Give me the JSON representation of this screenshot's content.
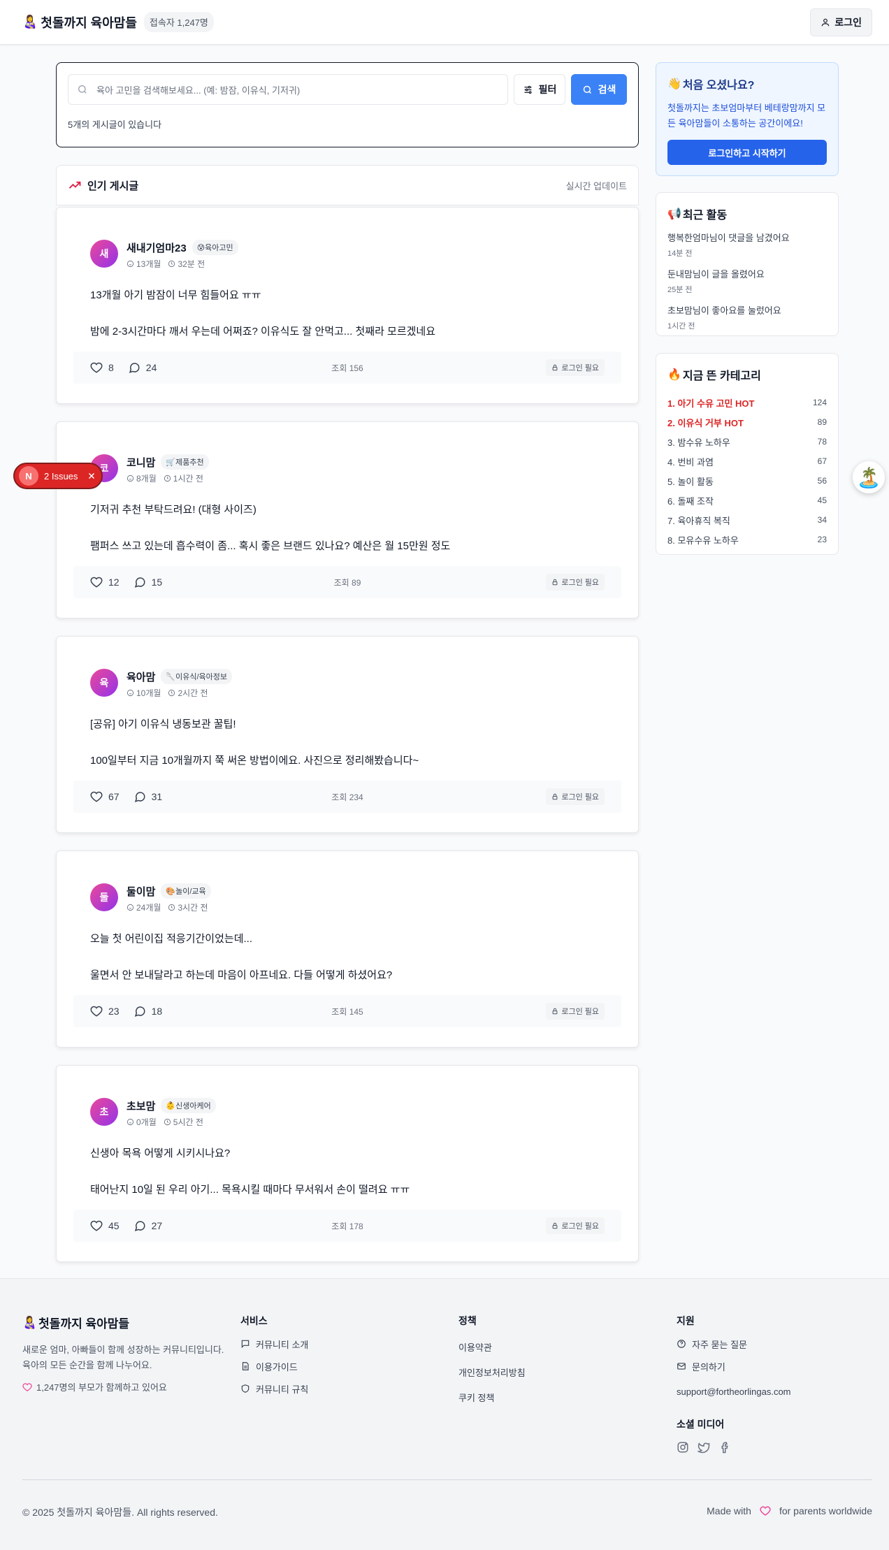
{
  "header": {
    "brand_emoji": "👩‍🍼",
    "brand": "첫돌까지 육아맘들",
    "online": "접속자 1,247명",
    "login": "로그인"
  },
  "search": {
    "placeholder": "육아 고민을 검색해보세요... (예: 밤잠, 이유식, 기저귀)",
    "filter": "필터",
    "submit": "검색",
    "count": "5개의 게시글이 있습니다"
  },
  "popular": {
    "title": "인기 게시글",
    "realtime": "실시간 업데이트"
  },
  "posts": [
    {
      "avatar": "새",
      "author": "새내기엄마23",
      "category": "😰육아고민",
      "age": "13개월",
      "time": "32분 전",
      "title": "13개월 아기 밤잠이 너무 힘들어요 ㅠㅠ",
      "body": "밤에 2-3시간마다 깨서 우는데 어쩌죠? 이유식도 잘 안먹고... 첫째라 모르겠네요",
      "likes": "8",
      "comments": "24",
      "views": "조회 156",
      "login_needed": "로그인 필요"
    },
    {
      "avatar": "코",
      "author": "코니맘",
      "category": "🛒제품추천",
      "age": "8개월",
      "time": "1시간 전",
      "title": "기저귀 추천 부탁드려요! (대형 사이즈)",
      "body": "팸퍼스 쓰고 있는데 흡수력이 좀... 혹시 좋은 브랜드 있나요? 예산은 월 15만원 정도",
      "likes": "12",
      "comments": "15",
      "views": "조회 89",
      "login_needed": "로그인 필요"
    },
    {
      "avatar": "육",
      "author": "육아맘",
      "category": "🥄이유식/육아정보",
      "age": "10개월",
      "time": "2시간 전",
      "title": "[공유] 아기 이유식 냉동보관 꿀팁!",
      "body": "100일부터 지금 10개월까지 쭉 써온 방법이에요. 사진으로 정리해봤습니다~",
      "likes": "67",
      "comments": "31",
      "views": "조회 234",
      "login_needed": "로그인 필요"
    },
    {
      "avatar": "둘",
      "author": "둘이맘",
      "category": "🎨놀이/교육",
      "age": "24개월",
      "time": "3시간 전",
      "title": "오늘 첫 어린이집 적응기간이었는데...",
      "body": "울면서 안 보내달라고 하는데 마음이 아프네요. 다들 어떻게 하셨어요?",
      "likes": "23",
      "comments": "18",
      "views": "조회 145",
      "login_needed": "로그인 필요"
    },
    {
      "avatar": "초",
      "author": "초보맘",
      "category": "👶신생아케어",
      "age": "0개월",
      "time": "5시간 전",
      "title": "신생아 목욕 어떻게 시키시나요?",
      "body": "태어난지 10일 된 우리 아기... 목욕시킬 때마다 무서워서 손이 떨려요 ㅠㅠ",
      "likes": "45",
      "comments": "27",
      "views": "조회 178",
      "login_needed": "로그인 필요"
    }
  ],
  "sidebar": {
    "welcome": {
      "emoji": "👋",
      "title": "처음 오셨나요?",
      "text": "첫돌까지는 초보엄마부터 베테랑맘까지 모든 육아맘들이 소통하는 공간이에요!",
      "cta": "로그인하고 시작하기"
    },
    "recent": {
      "emoji": "📢",
      "title": "최근 활동",
      "items": [
        {
          "text": "행복한엄마님이 댓글을 남겼어요",
          "time": "14분 전"
        },
        {
          "text": "둔내맘님이 글을 올렸어요",
          "time": "25분 전"
        },
        {
          "text": "초보맘님이 좋아요를 눌렀어요",
          "time": "1시간 전"
        }
      ]
    },
    "hot": {
      "emoji": "🔥",
      "title": "지금 뜬 카테고리",
      "items": [
        {
          "label": "1. 아기 수유 고민 HOT",
          "count": "124"
        },
        {
          "label": "2. 이유식 거부 HOT",
          "count": "89"
        },
        {
          "label": "3. 밤수유 노하우",
          "count": "78"
        },
        {
          "label": "4. 번비 과염",
          "count": "67"
        },
        {
          "label": "5. 놀이 활동",
          "count": "56"
        },
        {
          "label": "6. 돌째 조작",
          "count": "45"
        },
        {
          "label": "7. 육아휴직 복직",
          "count": "34"
        },
        {
          "label": "8. 모유수유 노하우",
          "count": "23"
        }
      ]
    }
  },
  "floating": {
    "issues_letter": "N",
    "issues": "2 Issues",
    "beach_emoji": "🏝️"
  },
  "footer": {
    "brand_emoji": "👩‍🍼",
    "brand": "첫돌까지 육아맘들",
    "desc": "새로운 엄마, 아빠들이 함께 성장하는 커뮤니티입니다. 육아의 모든 순간을 함께 나누어요.",
    "love": "1,247명의 부모가 함께하고 있어요",
    "service_head": "서비스",
    "service": [
      "커뮤니티 소개",
      "이용가이드",
      "커뮤니티 규칙"
    ],
    "policy_head": "정책",
    "policy": [
      "이용약관",
      "개인정보처리방침",
      "쿠키 정책"
    ],
    "support_head": "지원",
    "faq": "자주 묻는 질문",
    "contact": "문의하기",
    "email": "support@fortheorlingas.com",
    "social_head": "소셜 미디어",
    "copyright": "© 2025 첫돌까지 육아맘들. All rights reserved.",
    "made_with": "Made with",
    "for_parents": "for parents worldwide"
  },
  "colors": {
    "primary": "#3b82f6",
    "cta": "#2563eb",
    "hot": "#dc2626",
    "avatar": "#c026d3"
  }
}
